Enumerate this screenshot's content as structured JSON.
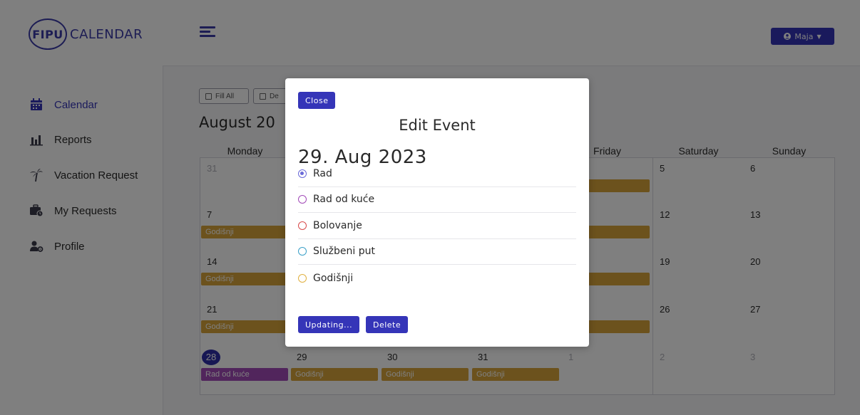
{
  "header": {
    "logo_badge": "FIPU",
    "logo_text": "CALENDAR",
    "user_name": "Maja"
  },
  "sidebar": {
    "items": [
      {
        "label": "Calendar",
        "icon": "calendar-icon",
        "active": true
      },
      {
        "label": "Reports",
        "icon": "bar-chart-icon",
        "active": false
      },
      {
        "label": "Vacation Request",
        "icon": "palm-tree-icon",
        "active": false
      },
      {
        "label": "My Requests",
        "icon": "briefcase-clock-icon",
        "active": false
      },
      {
        "label": "Profile",
        "icon": "user-cog-icon",
        "active": false
      }
    ]
  },
  "toolbar": {
    "fill_all": "Fill All",
    "delete_partial": "De"
  },
  "calendar": {
    "month_title": "August 20",
    "weekdays": [
      "Monday",
      "",
      "",
      "",
      "Friday",
      "Saturday",
      "Sunday"
    ],
    "weeks": [
      [
        {
          "day": "31",
          "muted": true,
          "event": ""
        },
        {
          "day": "",
          "muted": false,
          "event": ""
        },
        {
          "day": "",
          "muted": false,
          "event": ""
        },
        {
          "day": "",
          "muted": false,
          "event": ""
        },
        {
          "day": "",
          "muted": false,
          "event": "šnji"
        },
        {
          "day": "5",
          "muted": false,
          "event": ""
        },
        {
          "day": "6",
          "muted": false,
          "event": ""
        }
      ],
      [
        {
          "day": "7",
          "muted": false,
          "event": "Godišnji"
        },
        {
          "day": "",
          "muted": false,
          "event": ""
        },
        {
          "day": "",
          "muted": false,
          "event": ""
        },
        {
          "day": "",
          "muted": false,
          "event": ""
        },
        {
          "day": "",
          "muted": false,
          "event": "šnji"
        },
        {
          "day": "12",
          "muted": false,
          "event": ""
        },
        {
          "day": "13",
          "muted": false,
          "event": ""
        }
      ],
      [
        {
          "day": "14",
          "muted": false,
          "event": "Godišnji"
        },
        {
          "day": "",
          "muted": false,
          "event": ""
        },
        {
          "day": "",
          "muted": false,
          "event": ""
        },
        {
          "day": "",
          "muted": false,
          "event": ""
        },
        {
          "day": "",
          "muted": false,
          "event": "šnji"
        },
        {
          "day": "19",
          "muted": false,
          "event": ""
        },
        {
          "day": "20",
          "muted": false,
          "event": ""
        }
      ],
      [
        {
          "day": "21",
          "muted": false,
          "event": "Godišnji"
        },
        {
          "day": "",
          "muted": false,
          "event": ""
        },
        {
          "day": "",
          "muted": false,
          "event": ""
        },
        {
          "day": "",
          "muted": false,
          "event": ""
        },
        {
          "day": "",
          "muted": false,
          "event": "šnji"
        },
        {
          "day": "26",
          "muted": false,
          "event": ""
        },
        {
          "day": "27",
          "muted": false,
          "event": ""
        }
      ],
      [
        {
          "day": "28",
          "muted": false,
          "today": true,
          "event": "Rad od kuće",
          "event_type": "remote"
        },
        {
          "day": "29",
          "muted": false,
          "event": "Godišnji"
        },
        {
          "day": "30",
          "muted": false,
          "event": "Godišnji"
        },
        {
          "day": "31",
          "muted": false,
          "event": "Godišnji"
        },
        {
          "day": "1",
          "muted": true,
          "event": ""
        },
        {
          "day": "2",
          "muted": true,
          "event": ""
        },
        {
          "day": "3",
          "muted": true,
          "event": ""
        }
      ]
    ]
  },
  "modal": {
    "close_label": "Close",
    "title": "Edit Event",
    "date": "29. Aug 2023",
    "options": [
      {
        "label": "Rad",
        "color": "#6a6ad8",
        "checked": true
      },
      {
        "label": "Rad od kuće",
        "color": "#a24ab8",
        "checked": false
      },
      {
        "label": "Bolovanje",
        "color": "#d84a4a",
        "checked": false
      },
      {
        "label": "Službeni put",
        "color": "#3aa0c8",
        "checked": false
      },
      {
        "label": "Godišnji",
        "color": "#e0b040",
        "checked": false
      }
    ],
    "update_label": "Updating...",
    "delete_label": "Delete"
  },
  "colors": {
    "primary": "#3535b8",
    "vacation_event": "#d9a53a",
    "remote_event": "#a34ab9"
  }
}
